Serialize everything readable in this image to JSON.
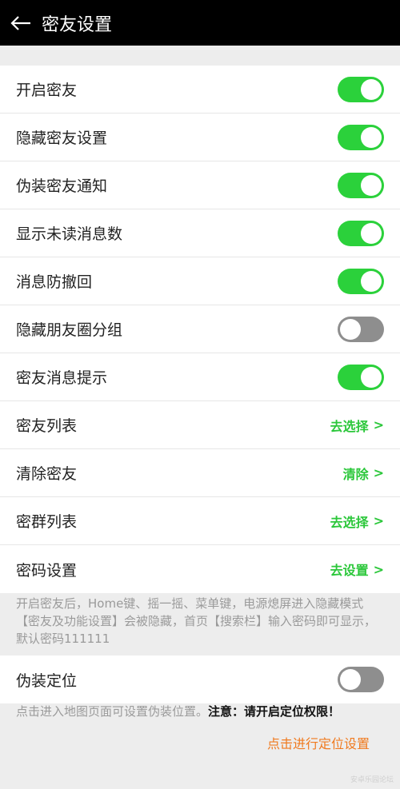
{
  "header": {
    "title": "密友设置",
    "back_icon": "back-arrow-icon"
  },
  "settings": [
    {
      "label": "开启密友",
      "type": "toggle",
      "on": true
    },
    {
      "label": "隐藏密友设置",
      "type": "toggle",
      "on": true
    },
    {
      "label": "伪装密友通知",
      "type": "toggle",
      "on": true
    },
    {
      "label": "显示未读消息数",
      "type": "toggle",
      "on": true
    },
    {
      "label": "消息防撤回",
      "type": "toggle",
      "on": true
    },
    {
      "label": "隐藏朋友圈分组",
      "type": "toggle",
      "on": false
    },
    {
      "label": "密友消息提示",
      "type": "toggle",
      "on": true
    },
    {
      "label": "密友列表",
      "type": "link",
      "action": "去选择"
    },
    {
      "label": "清除密友",
      "type": "link",
      "action": "清除"
    },
    {
      "label": "密群列表",
      "type": "link",
      "action": "去选择"
    },
    {
      "label": "密码设置",
      "type": "link",
      "action": "去设置"
    }
  ],
  "chevron": ">",
  "note1": "开启密友后，Home键、摇一摇、菜单键，电源熄屏进入隐藏模式【密友及功能设置】会被隐藏，首页【搜索栏】输入密码即可显示，默认密码111111",
  "location": {
    "label": "伪装定位",
    "on": false
  },
  "note2": {
    "text": "点击进入地图页面可设置伪装位置。",
    "warning": "注意：请开启定位权限！"
  },
  "location_link": "点击进行定位设置",
  "watermark": "安卓乐园论坛",
  "colors": {
    "toggle_on": "#2bd13b",
    "toggle_off": "#8e8e8e",
    "link_green": "#2bc73a",
    "link_orange": "#f07a1f",
    "header_bg": "#000000"
  }
}
